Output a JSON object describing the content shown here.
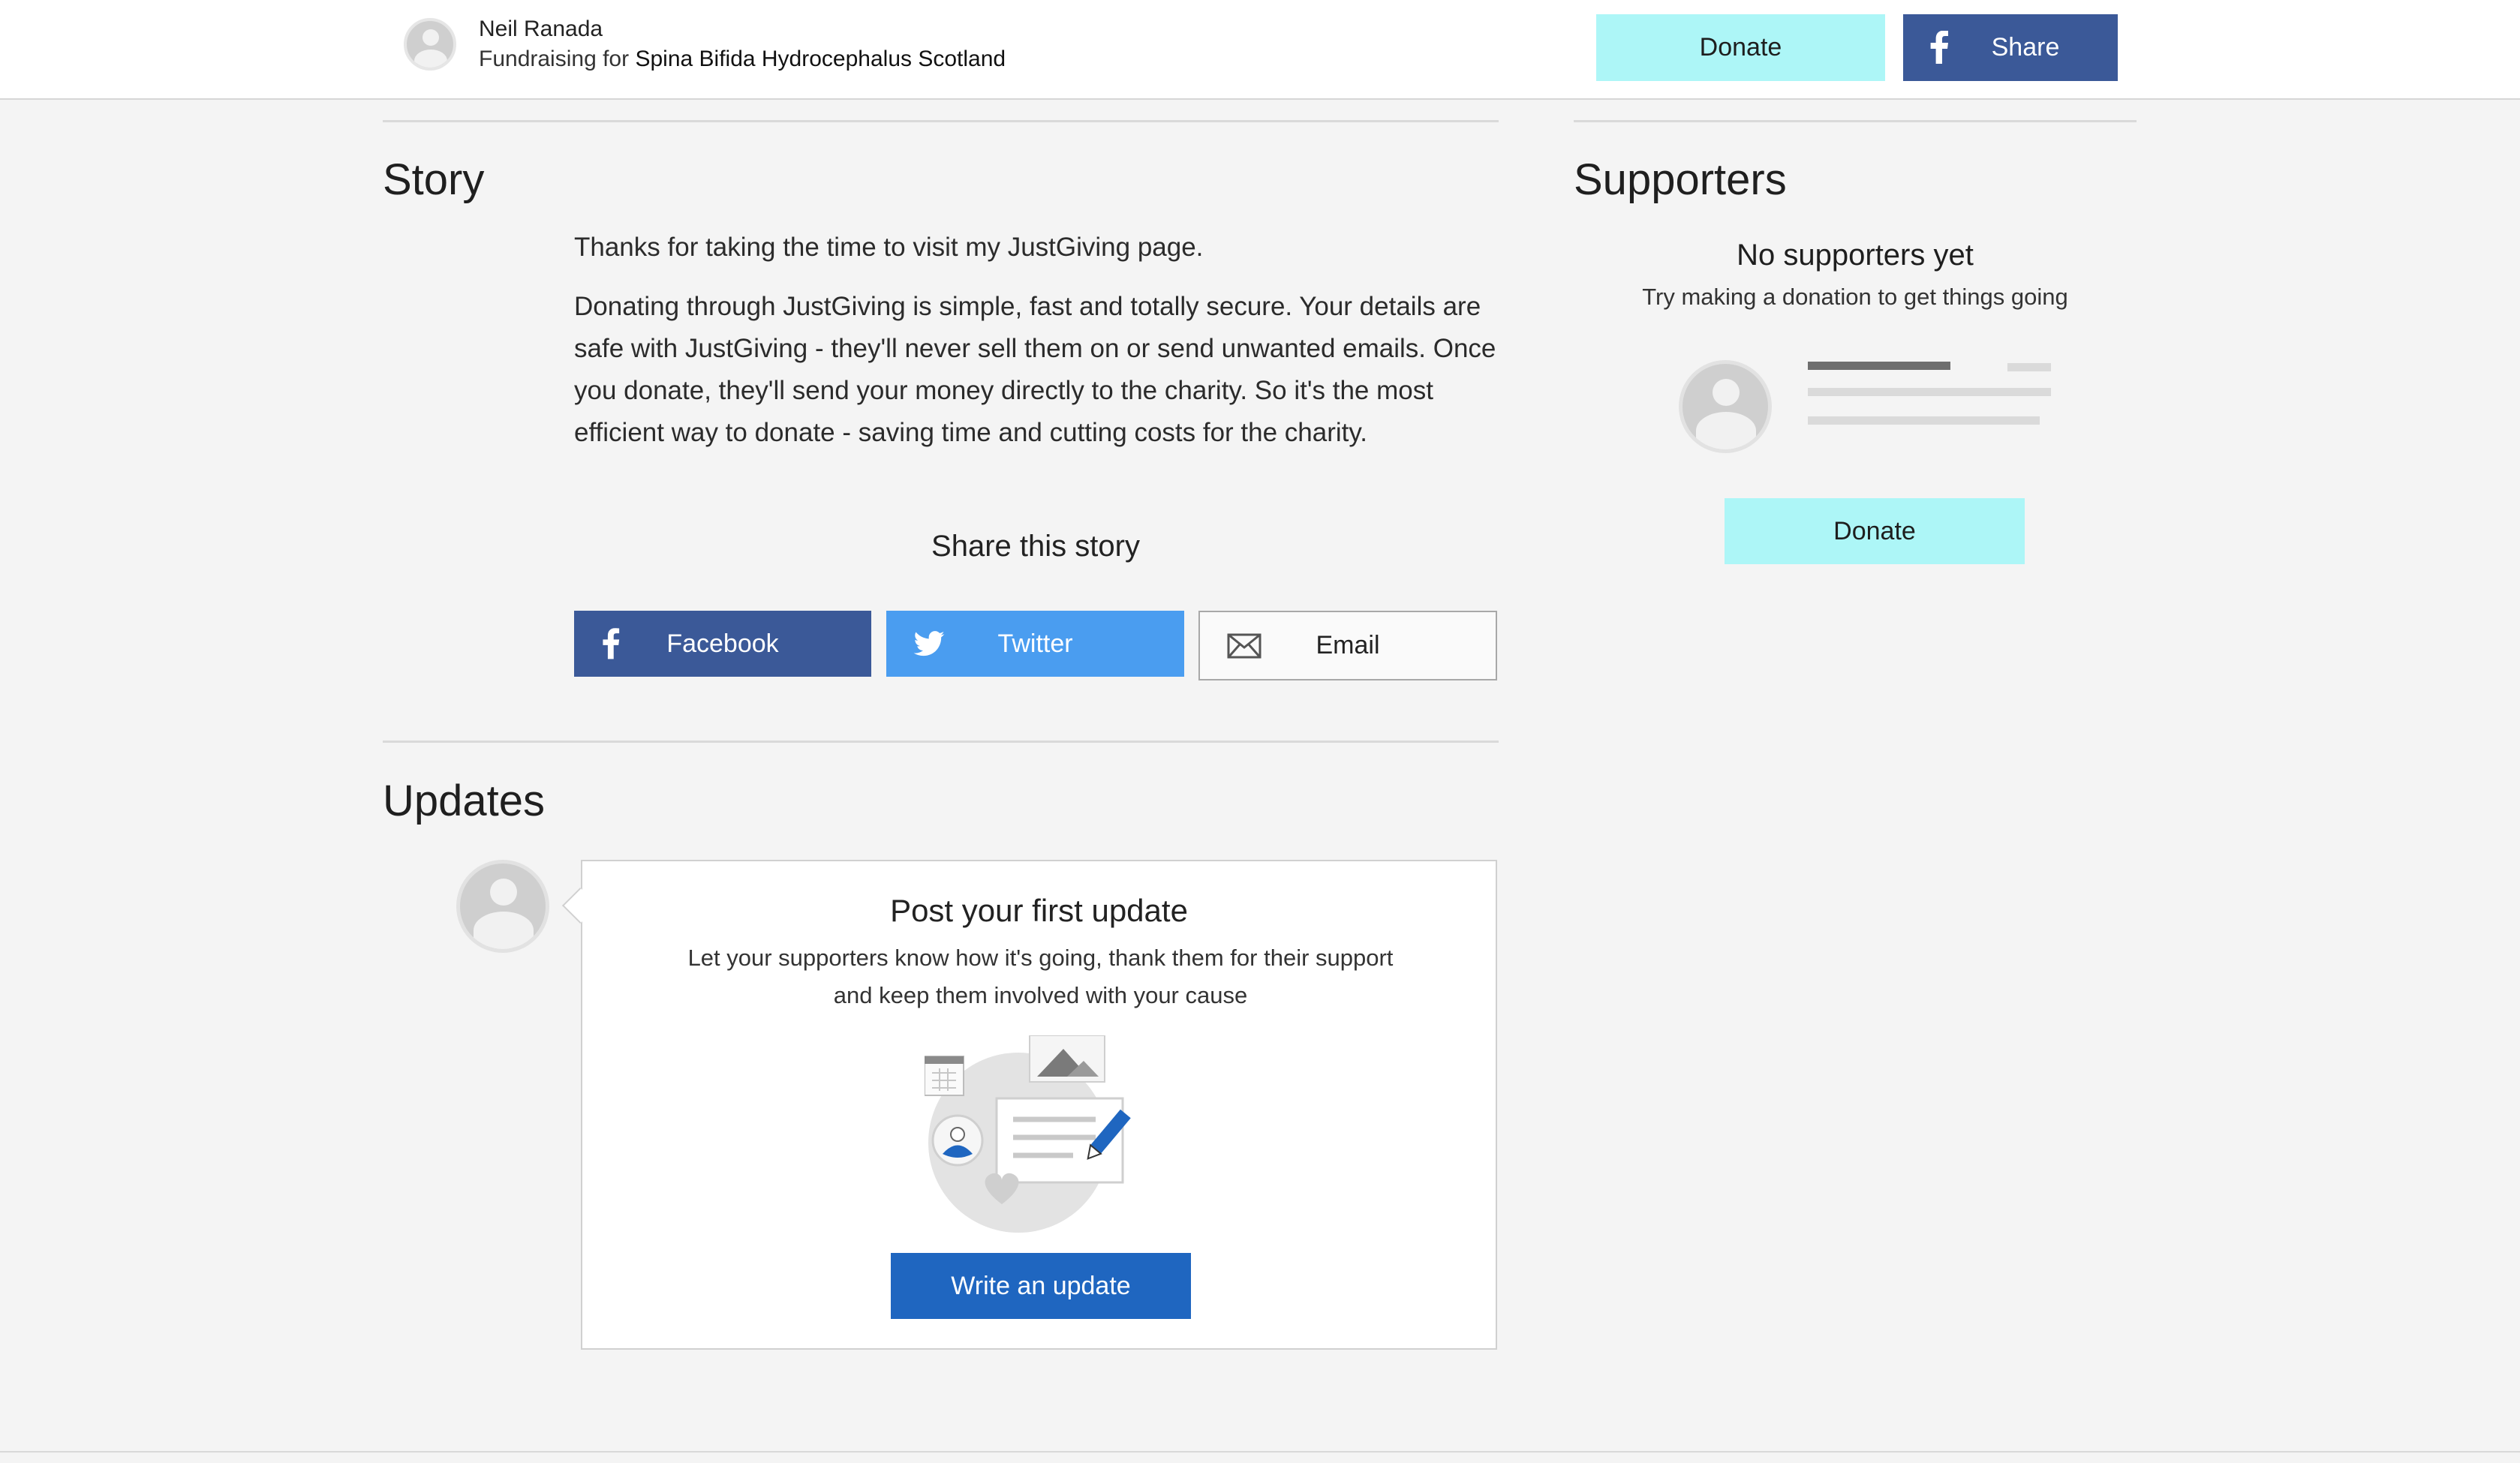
{
  "header": {
    "owner_name": "Neil Ranada",
    "fundraising_prefix": "Fundraising for",
    "charity_name": "Spina Bifida Hydrocephalus Scotland",
    "donate_label": "Donate",
    "share_label": "Share"
  },
  "story": {
    "title": "Story",
    "paragraphs": [
      "Thanks for taking the time to visit my JustGiving page.",
      "Donating through JustGiving is simple, fast and totally secure. Your details are safe with JustGiving - they'll never sell them on or send unwanted emails. Once you donate, they'll send your money directly to the charity. So it's the most efficient way to donate - saving time and cutting costs for the charity."
    ],
    "share_title": "Share this story",
    "share_buttons": {
      "facebook": "Facebook",
      "twitter": "Twitter",
      "email": "Email"
    }
  },
  "updates": {
    "title": "Updates",
    "card_title": "Post your first update",
    "card_text_line1": "Let your supporters know how it's going, thank them for their support",
    "card_text_line2": "and keep them involved with your cause",
    "write_label": "Write an update"
  },
  "supporters": {
    "title": "Supporters",
    "empty_title": "No supporters yet",
    "empty_sub": "Try making a donation to get things going",
    "donate_label": "Donate"
  },
  "colors": {
    "donate": "#adf6f7",
    "facebook": "#3b5998",
    "twitter": "#4a9df0",
    "primary": "#1f66c0"
  },
  "icons": [
    "avatar-icon",
    "facebook-icon",
    "twitter-icon",
    "email-icon",
    "update-illustration"
  ]
}
